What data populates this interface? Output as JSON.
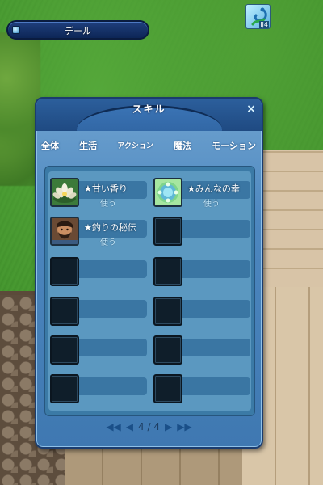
{
  "hud": {
    "name_bar_text": "デール",
    "top_icon_badge": "IJ4"
  },
  "skill_window": {
    "title": "スキル",
    "close_label": "×",
    "tabs": [
      {
        "label": "全体"
      },
      {
        "label": "生活"
      },
      {
        "label": "アクション"
      },
      {
        "label": "魔法"
      },
      {
        "label": "モーション"
      }
    ],
    "skills": [
      {
        "name": "★甘い香り",
        "action": "使う",
        "icon": "lotus-flower-icon"
      },
      {
        "name": "★みんなの幸",
        "action": "使う",
        "icon": "green-flower-icon"
      },
      {
        "name": "★釣りの秘伝",
        "action": "使う",
        "icon": "bearded-man-icon"
      },
      {
        "name": "",
        "action": "",
        "icon": ""
      },
      {
        "name": "",
        "action": "",
        "icon": ""
      },
      {
        "name": "",
        "action": "",
        "icon": ""
      },
      {
        "name": "",
        "action": "",
        "icon": ""
      },
      {
        "name": "",
        "action": "",
        "icon": ""
      },
      {
        "name": "",
        "action": "",
        "icon": ""
      },
      {
        "name": "",
        "action": "",
        "icon": ""
      },
      {
        "name": "",
        "action": "",
        "icon": ""
      },
      {
        "name": "",
        "action": "",
        "icon": ""
      }
    ],
    "pagination": {
      "current": 4,
      "total": 4,
      "text": "4 / 4",
      "first_icon": "double-left-arrow-icon",
      "prev_icon": "left-arrow-icon",
      "next_icon": "right-arrow-icon",
      "last_icon": "double-right-arrow-icon"
    }
  },
  "colors": {
    "panel_blue": "#4d87bf",
    "header_blue": "#1f4a82",
    "slot_bar": "#3a76a3",
    "grass": "#3f8f2a"
  }
}
